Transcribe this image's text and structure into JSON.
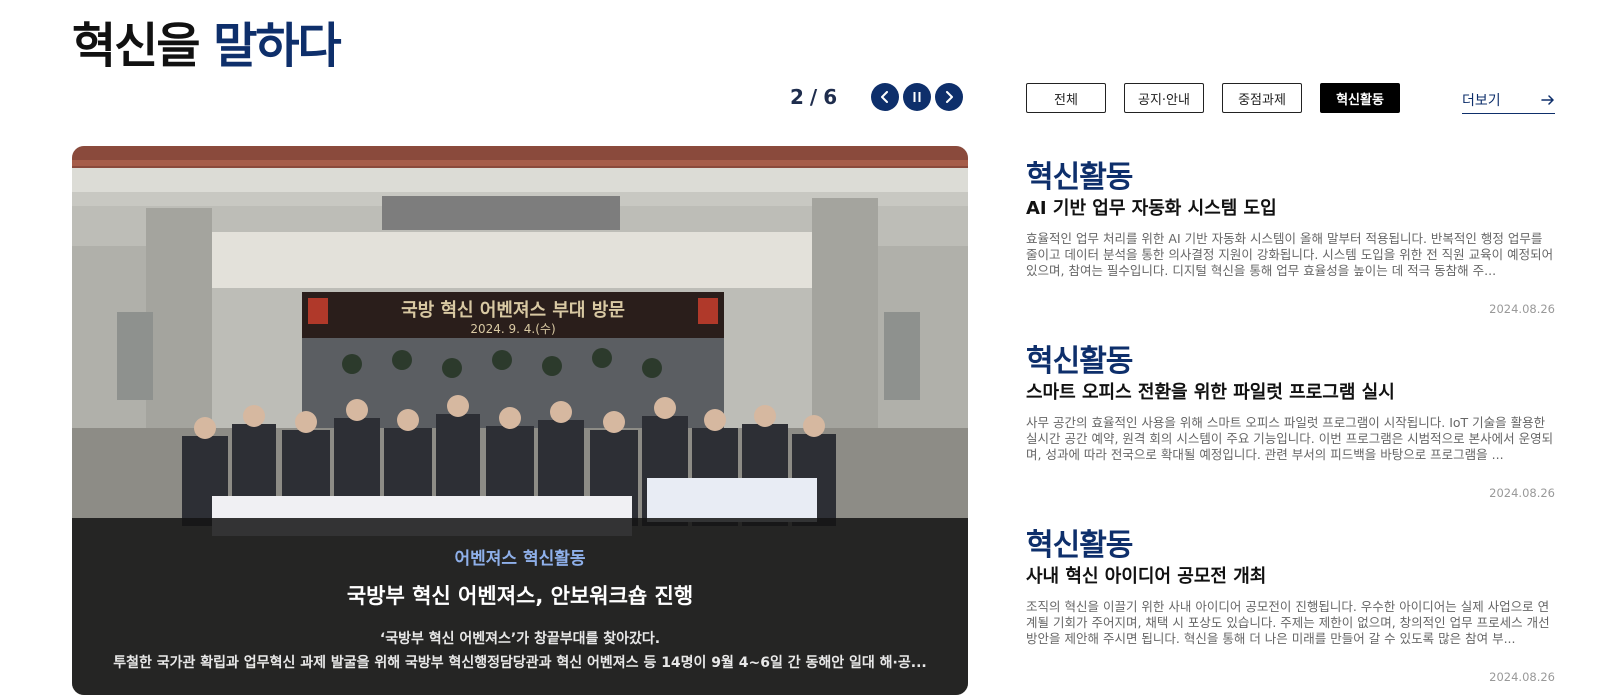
{
  "header": {
    "title_part1": "혁신을",
    "title_part2": "말하다"
  },
  "pager": {
    "current": "2",
    "separator": "/",
    "total": "6"
  },
  "controls": {
    "prev_icon": "chevron-left-icon",
    "pause_icon": "pause-icon",
    "next_icon": "chevron-right-icon"
  },
  "tabs": [
    {
      "label": "전체",
      "active": false
    },
    {
      "label": "공지·안내",
      "active": false
    },
    {
      "label": "중점과제",
      "active": false
    },
    {
      "label": "혁신활동",
      "active": true
    }
  ],
  "more": {
    "label": "더보기",
    "icon": "arrow-right-icon"
  },
  "feature": {
    "banner_text": "국방 혁신 어벤져스 부대 방문",
    "banner_date": "2024. 9. 4.(수)",
    "category": "어벤져스 혁신활동",
    "title": "국방부 혁신 어벤져스, 안보워크숍 진행",
    "subtitle": "‘국방부 혁신 어벤져스’가 창끝부대를 찾아갔다.",
    "description": "투철한 국가관 확립과 업무혁신 과제 발굴을 위해 국방부 혁신행정담당관과 혁신 어벤져스 등 14명이 9월 4~6일 간 동해안 일대 해·공..."
  },
  "news": [
    {
      "category": "혁신활동",
      "title": "AI 기반 업무 자동화 시스템 도입",
      "body": "효율적인 업무 처리를 위한 AI 기반 자동화 시스템이 올해 말부터 적용됩니다. 반복적인 행정 업무를 줄이고 데이터 분석을 통한 의사결정 지원이 강화됩니다. 시스템 도입을 위한 전 직원 교육이 예정되어 있으며, 참여는 필수입니다. 디지털 혁신을 통해 업무 효율성을 높이는 데 적극 동참해 주...",
      "date": "2024.08.26"
    },
    {
      "category": "혁신활동",
      "title": "스마트 오피스 전환을 위한 파일럿 프로그램 실시",
      "body": "사무 공간의 효율적인 사용을 위해 스마트 오피스 파일럿 프로그램이 시작됩니다. IoT 기술을 활용한 실시간 공간 예약, 원격 회의 시스템이 주요 기능입니다. 이번 프로그램은 시범적으로 본사에서 운영되며, 성과에 따라 전국으로 확대될 예정입니다. 관련 부서의 피드백을 바탕으로 프로그램을 ...",
      "date": "2024.08.26"
    },
    {
      "category": "혁신활동",
      "title": "사내 혁신 아이디어 공모전 개최",
      "body": "조직의 혁신을 이끌기 위한 사내 아이디어 공모전이 진행됩니다. 우수한 아이디어는 실제 사업으로 연계될 기회가 주어지며, 채택 시 포상도 있습니다. 주제는 제한이 없으며, 창의적인 업무 프로세스 개선 방안을 제안해 주시면 됩니다. 혁신을 통해 더 나은 미래를 만들어 갈 수 있도록 많은 참여 부...",
      "date": "2024.08.26"
    }
  ],
  "colors": {
    "accent": "#0e2f6b",
    "category_light": "#8fb0ea",
    "caption_bg": "#141414"
  }
}
